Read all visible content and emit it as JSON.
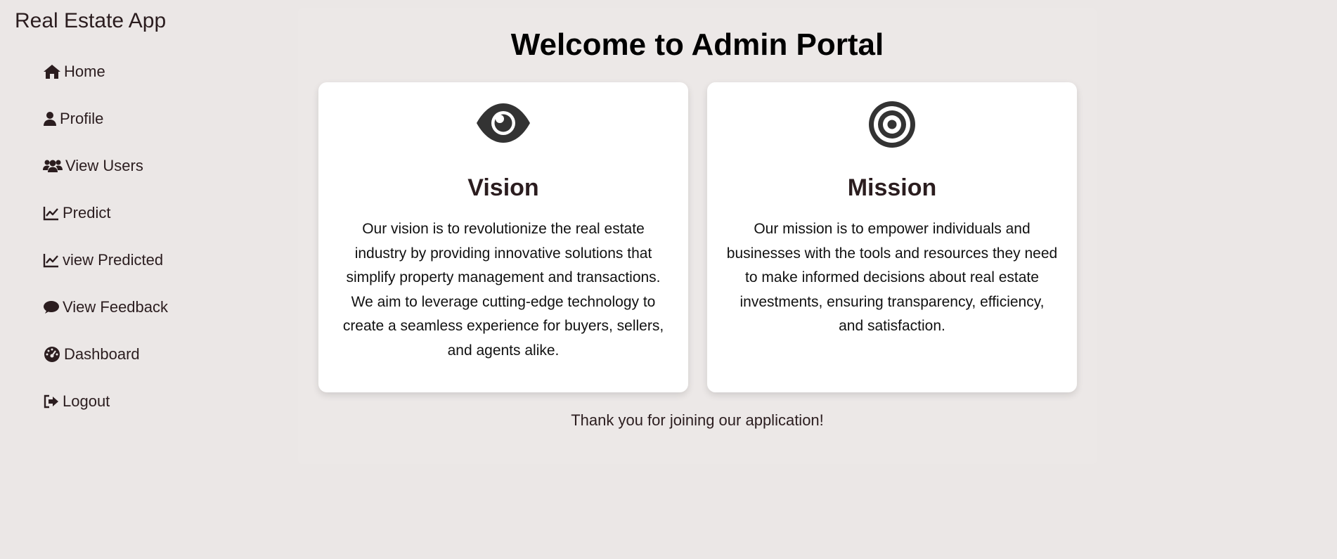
{
  "app": {
    "title": "Real Estate App"
  },
  "sidebar": {
    "items": [
      {
        "label": "Home",
        "icon": "home-icon"
      },
      {
        "label": "Profile",
        "icon": "user-icon"
      },
      {
        "label": "View Users",
        "icon": "users-icon"
      },
      {
        "label": "Predict",
        "icon": "chart-line-icon"
      },
      {
        "label": "view Predicted",
        "icon": "chart-line-icon"
      },
      {
        "label": "View Feedback",
        "icon": "comment-icon"
      },
      {
        "label": "Dashboard",
        "icon": "gauge-icon"
      },
      {
        "label": "Logout",
        "icon": "sign-out-icon"
      }
    ]
  },
  "main": {
    "title": "Welcome to Admin Portal",
    "cards": [
      {
        "icon": "eye-icon",
        "title": "Vision",
        "text": "Our vision is to revolutionize the real estate industry by providing innovative solutions that simplify property management and transactions. We aim to leverage cutting-edge technology to create a seamless experience for buyers, sellers, and agents alike."
      },
      {
        "icon": "bullseye-icon",
        "title": "Mission",
        "text": "Our mission is to empower individuals and businesses with the tools and resources they need to make informed decisions about real estate investments, ensuring transparency, efficiency, and satisfaction."
      }
    ],
    "footer_text": "Thank you for joining our application!"
  },
  "colors": {
    "background": "#ebe7e6",
    "text": "#2b1d1f",
    "card": "#ffffff",
    "icon": "#333333"
  }
}
